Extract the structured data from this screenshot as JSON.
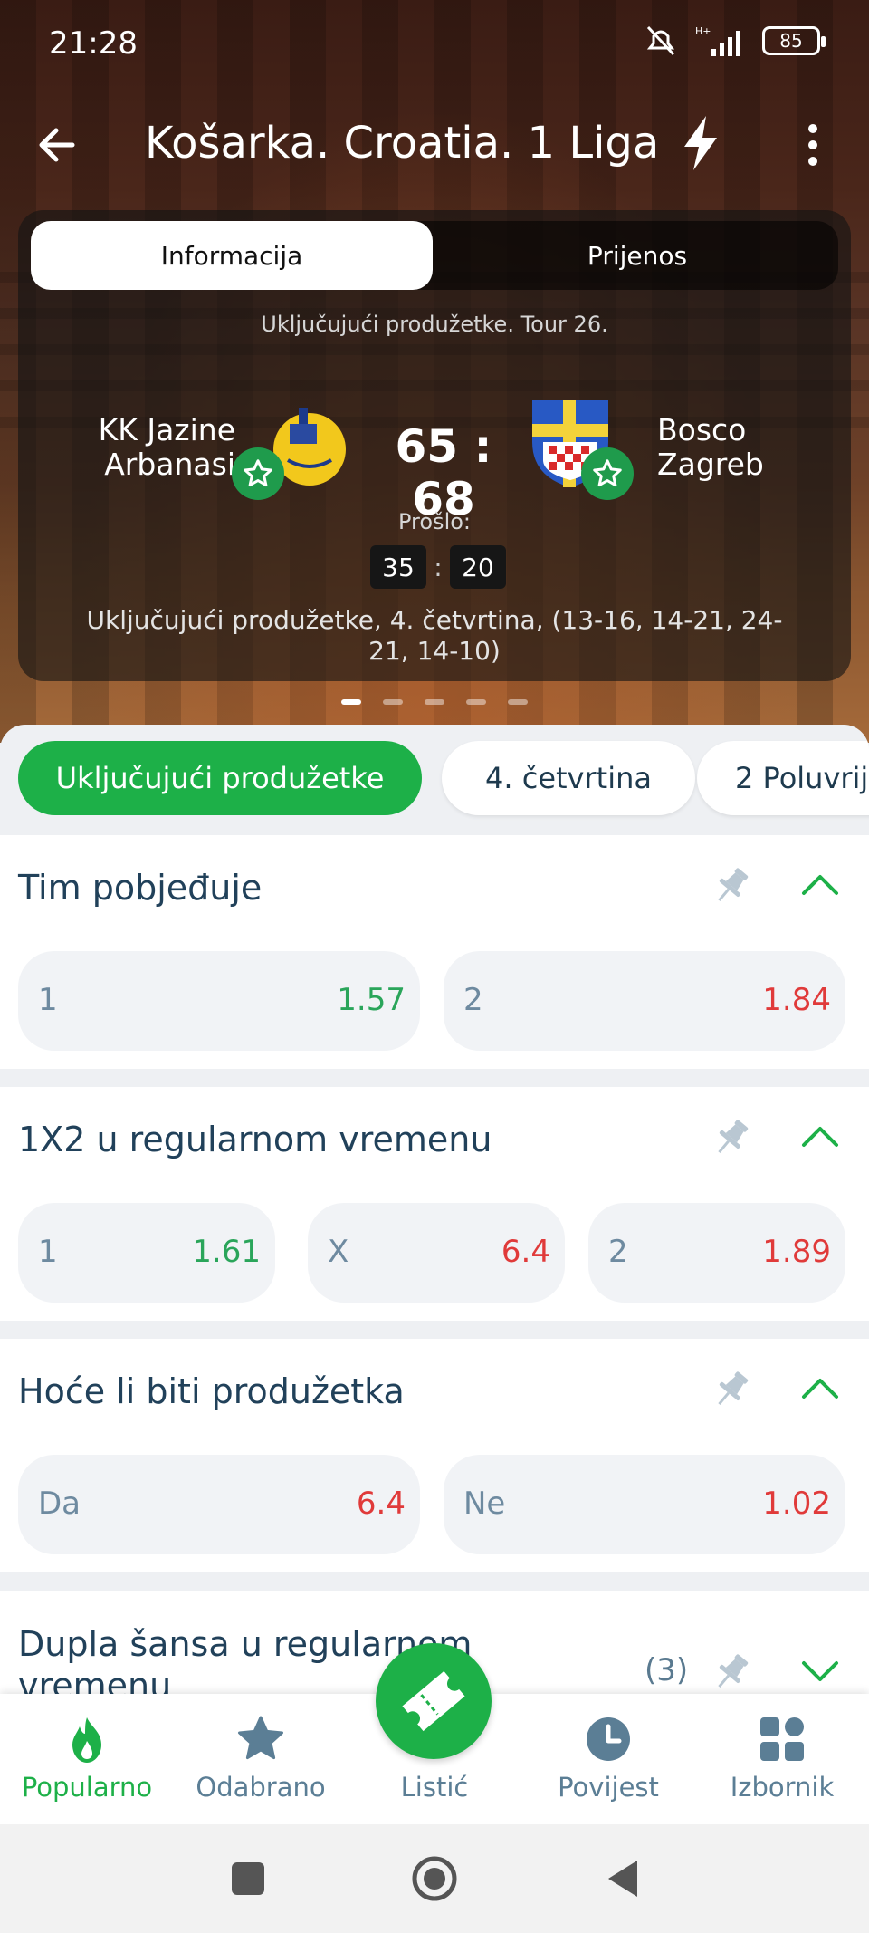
{
  "status_bar": {
    "time": "21:28",
    "battery": "85",
    "icons": [
      "mute-icon",
      "signal-icon",
      "battery-icon"
    ]
  },
  "app_bar": {
    "title": "Košarka. Croatia. 1 Liga",
    "icons": [
      "back-arrow-icon",
      "lightning-icon",
      "more-vertical-icon"
    ]
  },
  "match": {
    "tabs": [
      {
        "label": "Informacija",
        "active": true
      },
      {
        "label": "Prijenos",
        "active": false
      }
    ],
    "subtitle": "Uključujući produžetke. Tour 26.",
    "home": {
      "name_line1": "KK Jazine",
      "name_line2": "Arbanasi"
    },
    "away": {
      "name_line1": "Bosco",
      "name_line2": "Zagreb"
    },
    "score": "65 : 68",
    "previous_label": "Prošlo:",
    "previous": {
      "home": "35",
      "sep": ":",
      "away": "20"
    },
    "details": "Uključujući produžetke, 4. četvrtina, (13-16, 14-21, 24-21, 14-10)",
    "pager": {
      "count": 5,
      "active_index": 0
    }
  },
  "filter_chips": [
    {
      "label": "Uključujući produžetke",
      "active": true
    },
    {
      "label": "4. četvrtina",
      "active": false
    },
    {
      "label": "2 Poluvrij",
      "active": false
    }
  ],
  "markets": [
    {
      "title": "Tim pobjeđuje",
      "expanded": true,
      "odds": [
        {
          "label": "1",
          "value": "1.57",
          "trend": "up"
        },
        {
          "label": "2",
          "value": "1.84",
          "trend": "down"
        }
      ]
    },
    {
      "title": "1X2 u regularnom vremenu",
      "expanded": true,
      "odds": [
        {
          "label": "1",
          "value": "1.61",
          "trend": "up"
        },
        {
          "label": "X",
          "value": "6.4",
          "trend": "down"
        },
        {
          "label": "2",
          "value": "1.89",
          "trend": "down"
        }
      ]
    },
    {
      "title": "Hoće li biti produžetka",
      "expanded": true,
      "odds": [
        {
          "label": "Da",
          "value": "6.4",
          "trend": "down"
        },
        {
          "label": "Ne",
          "value": "1.02",
          "trend": "down"
        }
      ]
    },
    {
      "title": "Dupla šansa u regularnom vremenu",
      "count": "(3)",
      "expanded": false
    }
  ],
  "bottom_nav": [
    {
      "label": "Popularno",
      "icon": "flame-icon",
      "active": true
    },
    {
      "label": "Odabrano",
      "icon": "star-icon",
      "active": false
    },
    {
      "label": "Listić",
      "icon": "ticket-icon",
      "active": false
    },
    {
      "label": "Povijest",
      "icon": "clock-icon",
      "active": false
    },
    {
      "label": "Izbornik",
      "icon": "grid-icon",
      "active": false
    }
  ],
  "colors": {
    "accent_green": "#1db048",
    "odds_up": "#2aa55a",
    "odds_down": "#e03a3a",
    "title_text": "#21415a"
  }
}
